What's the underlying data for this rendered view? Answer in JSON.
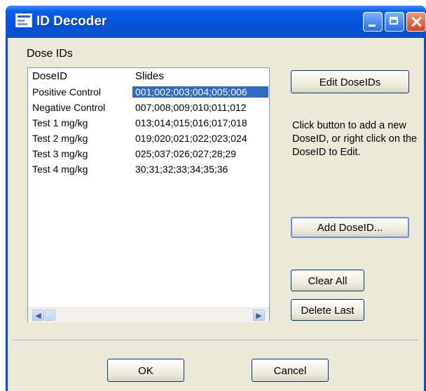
{
  "window": {
    "title": "ID Decoder"
  },
  "group": {
    "label": "Dose IDs"
  },
  "list": {
    "columns": [
      "DoseID",
      "Slides"
    ],
    "rows": [
      {
        "dose": "Positive Control",
        "slides": "001;002;003;004;005;006",
        "selected": true
      },
      {
        "dose": "Negative Control",
        "slides": "007;008;009;010;011;012",
        "selected": false
      },
      {
        "dose": "Test 1 mg/kg",
        "slides": "013;014;015;016;017;018",
        "selected": false
      },
      {
        "dose": "Test 2 mg/kg",
        "slides": "019;020;021;022;023;024",
        "selected": false
      },
      {
        "dose": "Test 3 mg/kg",
        "slides": "025;037;026;027;28;29",
        "selected": false
      },
      {
        "dose": "Test 4 mg/kg",
        "slides": "30;31;32;33;34;35;36",
        "selected": false
      }
    ]
  },
  "buttons": {
    "edit": "Edit DoseIDs",
    "add": "Add DoseID...",
    "clear": "Clear All",
    "delete": "Delete Last",
    "ok": "OK",
    "cancel": "Cancel"
  },
  "help_text": "Click button to add a new DoseID, or right click on the DoseID to Edit.",
  "icons": {
    "scroll_left": "◀",
    "scroll_right": "▶"
  },
  "colors": {
    "selection": "#316ac5",
    "titlebar": "#0553d8",
    "dialog_bg": "#ece9d8"
  }
}
